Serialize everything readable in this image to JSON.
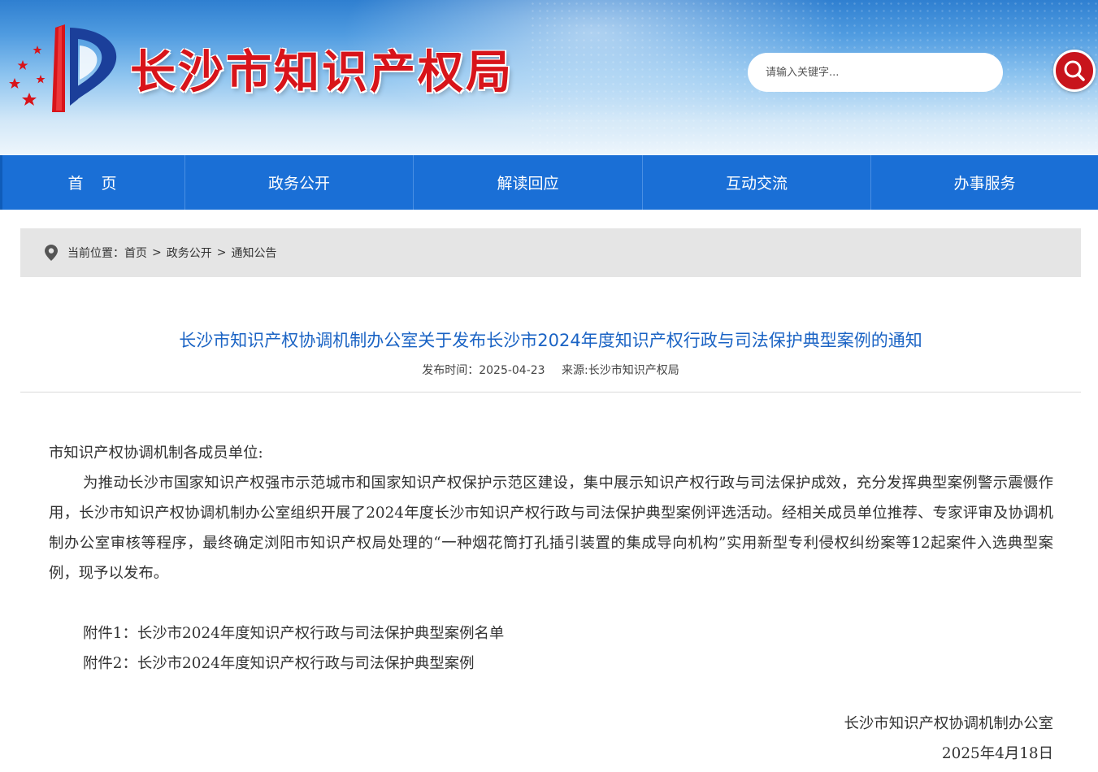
{
  "header": {
    "site_title": "长沙市知识产权局",
    "search_placeholder": "请输入关键字...",
    "logo_icon": "ip-emblem-icon",
    "search_icon": "search-icon"
  },
  "nav": {
    "items": [
      {
        "label": "首页"
      },
      {
        "label": "政务公开"
      },
      {
        "label": "解读回应"
      },
      {
        "label": "互动交流"
      },
      {
        "label": "办事服务"
      }
    ]
  },
  "breadcrumb": {
    "prefix": "当前位置：",
    "items": [
      "首页",
      "政务公开",
      "通知公告"
    ],
    "separator": ">"
  },
  "article": {
    "title": "长沙市知识产权协调机制办公室关于发布长沙市2024年度知识产权行政与司法保护典型案例的通知",
    "publish_time": "发布时间：2025-04-23",
    "source": "来源:长沙市知识产权局",
    "salutation": "市知识产权协调机制各成员单位:",
    "paragraph": "为推动长沙市国家知识产权强市示范城市和国家知识产权保护示范区建设，集中展示知识产权行政与司法保护成效，充分发挥典型案例警示震慑作用，长沙市知识产权协调机制办公室组织开展了2024年度长沙市知识产权行政与司法保护典型案例评选活动。经相关成员单位推荐、专家评审及协调机制办公室审核等程序，最终确定浏阳市知识产权局处理的“一种烟花筒打孔插引装置的集成导向机构”实用新型专利侵权纠纷案等12起案件入选典型案例，现予以发布。",
    "attachments": [
      "附件1：长沙市2024年度知识产权行政与司法保护典型案例名单",
      "附件2：长沙市2024年度知识产权行政与司法保护典型案例"
    ],
    "signature": "长沙市知识产权协调机制办公室",
    "date": "2025年4月18日"
  },
  "colors": {
    "nav_bg": "#1a6fd6",
    "title_red": "#d8141a",
    "article_title_blue": "#1a63c4",
    "search_button_red": "#c8141c"
  }
}
